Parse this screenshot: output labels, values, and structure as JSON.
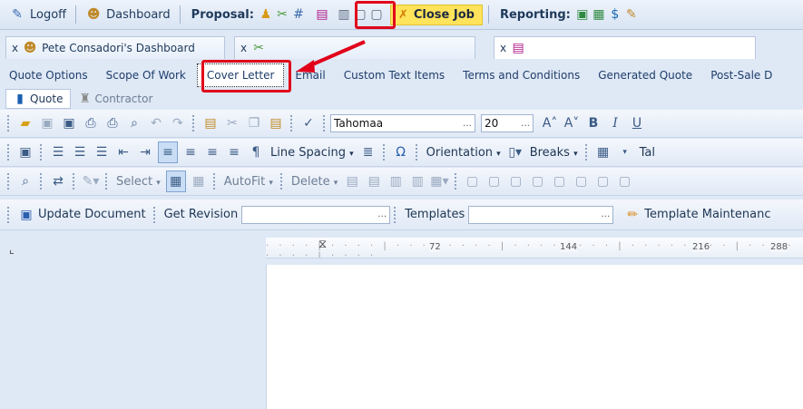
{
  "menubar": {
    "logoff": "Logoff",
    "dashboard": "Dashboard",
    "proposal_label": "Proposal:",
    "close_job": "Close Job",
    "reporting_label": "Reporting:"
  },
  "doc_tabs": [
    {
      "close": "x",
      "label": "Pete Consadori's Dashboard"
    },
    {
      "close": "x",
      "label": ""
    },
    {
      "close": "x",
      "label": ""
    }
  ],
  "sub_tabs": [
    "Quote Options",
    "Scope Of Work",
    "Cover Letter",
    "Email",
    "Custom Text Items",
    "Terms and Conditions",
    "Generated Quote",
    "Post-Sale D"
  ],
  "inner_tabs": [
    "Quote",
    "Contractor"
  ],
  "toolbar1": {
    "font_name": "Tahomaa",
    "font_size": "20",
    "bold": "B",
    "italic": "I",
    "underline": "U"
  },
  "toolbar2": {
    "pilcrow": "¶",
    "line_spacing": "Line Spacing",
    "omega": "Ω",
    "orientation": "Orientation",
    "breaks": "Breaks",
    "tab": "Tal"
  },
  "toolbar3": {
    "select": "Select",
    "autofit": "AutoFit",
    "delete": "Delete"
  },
  "toolbar4": {
    "update_document": "Update Document",
    "get_revision": "Get Revision",
    "templates": "Templates",
    "template_maintenance": "Template Maintenanc"
  },
  "ruler": {
    "marks": [
      "72",
      "144",
      "216",
      "288"
    ]
  },
  "colors": {
    "highlight": "#e1001a",
    "close_job_bg": "#ffe35a"
  }
}
